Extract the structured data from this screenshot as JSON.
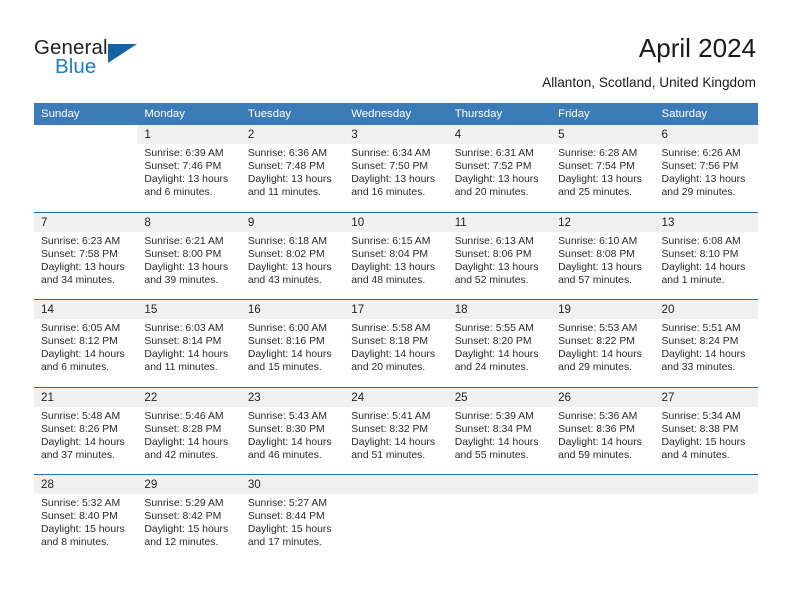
{
  "brand": {
    "word_one": "General",
    "word_two": "Blue",
    "accent_color": "#1b7fc4",
    "triangle_color": "#1464a5",
    "triangle_icon": "triangle-icon"
  },
  "header": {
    "title": "April 2024",
    "location": "Allanton, Scotland, United Kingdom",
    "header_bg_color": "#3b7cb8",
    "band_bg_color": "#f0f0f0",
    "separator_color": "#2e6da4"
  },
  "labels": {
    "sunrise_prefix": "Sunrise:",
    "sunset_prefix": "Sunset:",
    "daylight_prefix": "Daylight:"
  },
  "weekday_headers": [
    "Sunday",
    "Monday",
    "Tuesday",
    "Wednesday",
    "Thursday",
    "Friday",
    "Saturday"
  ],
  "weeks": [
    {
      "days": [
        {
          "num": "",
          "sunrise": "",
          "sunset": "",
          "daylight_1": "",
          "daylight_2": "",
          "empty": true
        },
        {
          "num": "1",
          "sunrise": "Sunrise: 6:39 AM",
          "sunset": "Sunset: 7:46 PM",
          "daylight_1": "Daylight: 13 hours",
          "daylight_2": "and 6 minutes.",
          "empty": false
        },
        {
          "num": "2",
          "sunrise": "Sunrise: 6:36 AM",
          "sunset": "Sunset: 7:48 PM",
          "daylight_1": "Daylight: 13 hours",
          "daylight_2": "and 11 minutes.",
          "empty": false
        },
        {
          "num": "3",
          "sunrise": "Sunrise: 6:34 AM",
          "sunset": "Sunset: 7:50 PM",
          "daylight_1": "Daylight: 13 hours",
          "daylight_2": "and 16 minutes.",
          "empty": false
        },
        {
          "num": "4",
          "sunrise": "Sunrise: 6:31 AM",
          "sunset": "Sunset: 7:52 PM",
          "daylight_1": "Daylight: 13 hours",
          "daylight_2": "and 20 minutes.",
          "empty": false
        },
        {
          "num": "5",
          "sunrise": "Sunrise: 6:28 AM",
          "sunset": "Sunset: 7:54 PM",
          "daylight_1": "Daylight: 13 hours",
          "daylight_2": "and 25 minutes.",
          "empty": false
        },
        {
          "num": "6",
          "sunrise": "Sunrise: 6:26 AM",
          "sunset": "Sunset: 7:56 PM",
          "daylight_1": "Daylight: 13 hours",
          "daylight_2": "and 29 minutes.",
          "empty": false
        }
      ]
    },
    {
      "days": [
        {
          "num": "7",
          "sunrise": "Sunrise: 6:23 AM",
          "sunset": "Sunset: 7:58 PM",
          "daylight_1": "Daylight: 13 hours",
          "daylight_2": "and 34 minutes.",
          "empty": false
        },
        {
          "num": "8",
          "sunrise": "Sunrise: 6:21 AM",
          "sunset": "Sunset: 8:00 PM",
          "daylight_1": "Daylight: 13 hours",
          "daylight_2": "and 39 minutes.",
          "empty": false
        },
        {
          "num": "9",
          "sunrise": "Sunrise: 6:18 AM",
          "sunset": "Sunset: 8:02 PM",
          "daylight_1": "Daylight: 13 hours",
          "daylight_2": "and 43 minutes.",
          "empty": false
        },
        {
          "num": "10",
          "sunrise": "Sunrise: 6:15 AM",
          "sunset": "Sunset: 8:04 PM",
          "daylight_1": "Daylight: 13 hours",
          "daylight_2": "and 48 minutes.",
          "empty": false
        },
        {
          "num": "11",
          "sunrise": "Sunrise: 6:13 AM",
          "sunset": "Sunset: 8:06 PM",
          "daylight_1": "Daylight: 13 hours",
          "daylight_2": "and 52 minutes.",
          "empty": false
        },
        {
          "num": "12",
          "sunrise": "Sunrise: 6:10 AM",
          "sunset": "Sunset: 8:08 PM",
          "daylight_1": "Daylight: 13 hours",
          "daylight_2": "and 57 minutes.",
          "empty": false
        },
        {
          "num": "13",
          "sunrise": "Sunrise: 6:08 AM",
          "sunset": "Sunset: 8:10 PM",
          "daylight_1": "Daylight: 14 hours",
          "daylight_2": "and 1 minute.",
          "empty": false
        }
      ]
    },
    {
      "days": [
        {
          "num": "14",
          "sunrise": "Sunrise: 6:05 AM",
          "sunset": "Sunset: 8:12 PM",
          "daylight_1": "Daylight: 14 hours",
          "daylight_2": "and 6 minutes.",
          "empty": false
        },
        {
          "num": "15",
          "sunrise": "Sunrise: 6:03 AM",
          "sunset": "Sunset: 8:14 PM",
          "daylight_1": "Daylight: 14 hours",
          "daylight_2": "and 11 minutes.",
          "empty": false
        },
        {
          "num": "16",
          "sunrise": "Sunrise: 6:00 AM",
          "sunset": "Sunset: 8:16 PM",
          "daylight_1": "Daylight: 14 hours",
          "daylight_2": "and 15 minutes.",
          "empty": false
        },
        {
          "num": "17",
          "sunrise": "Sunrise: 5:58 AM",
          "sunset": "Sunset: 8:18 PM",
          "daylight_1": "Daylight: 14 hours",
          "daylight_2": "and 20 minutes.",
          "empty": false
        },
        {
          "num": "18",
          "sunrise": "Sunrise: 5:55 AM",
          "sunset": "Sunset: 8:20 PM",
          "daylight_1": "Daylight: 14 hours",
          "daylight_2": "and 24 minutes.",
          "empty": false
        },
        {
          "num": "19",
          "sunrise": "Sunrise: 5:53 AM",
          "sunset": "Sunset: 8:22 PM",
          "daylight_1": "Daylight: 14 hours",
          "daylight_2": "and 29 minutes.",
          "empty": false
        },
        {
          "num": "20",
          "sunrise": "Sunrise: 5:51 AM",
          "sunset": "Sunset: 8:24 PM",
          "daylight_1": "Daylight: 14 hours",
          "daylight_2": "and 33 minutes.",
          "empty": false
        }
      ]
    },
    {
      "days": [
        {
          "num": "21",
          "sunrise": "Sunrise: 5:48 AM",
          "sunset": "Sunset: 8:26 PM",
          "daylight_1": "Daylight: 14 hours",
          "daylight_2": "and 37 minutes.",
          "empty": false
        },
        {
          "num": "22",
          "sunrise": "Sunrise: 5:46 AM",
          "sunset": "Sunset: 8:28 PM",
          "daylight_1": "Daylight: 14 hours",
          "daylight_2": "and 42 minutes.",
          "empty": false
        },
        {
          "num": "23",
          "sunrise": "Sunrise: 5:43 AM",
          "sunset": "Sunset: 8:30 PM",
          "daylight_1": "Daylight: 14 hours",
          "daylight_2": "and 46 minutes.",
          "empty": false
        },
        {
          "num": "24",
          "sunrise": "Sunrise: 5:41 AM",
          "sunset": "Sunset: 8:32 PM",
          "daylight_1": "Daylight: 14 hours",
          "daylight_2": "and 51 minutes.",
          "empty": false
        },
        {
          "num": "25",
          "sunrise": "Sunrise: 5:39 AM",
          "sunset": "Sunset: 8:34 PM",
          "daylight_1": "Daylight: 14 hours",
          "daylight_2": "and 55 minutes.",
          "empty": false
        },
        {
          "num": "26",
          "sunrise": "Sunrise: 5:36 AM",
          "sunset": "Sunset: 8:36 PM",
          "daylight_1": "Daylight: 14 hours",
          "daylight_2": "and 59 minutes.",
          "empty": false
        },
        {
          "num": "27",
          "sunrise": "Sunrise: 5:34 AM",
          "sunset": "Sunset: 8:38 PM",
          "daylight_1": "Daylight: 15 hours",
          "daylight_2": "and 4 minutes.",
          "empty": false
        }
      ]
    },
    {
      "days": [
        {
          "num": "28",
          "sunrise": "Sunrise: 5:32 AM",
          "sunset": "Sunset: 8:40 PM",
          "daylight_1": "Daylight: 15 hours",
          "daylight_2": "and 8 minutes.",
          "empty": false
        },
        {
          "num": "29",
          "sunrise": "Sunrise: 5:29 AM",
          "sunset": "Sunset: 8:42 PM",
          "daylight_1": "Daylight: 15 hours",
          "daylight_2": "and 12 minutes.",
          "empty": false
        },
        {
          "num": "30",
          "sunrise": "Sunrise: 5:27 AM",
          "sunset": "Sunset: 8:44 PM",
          "daylight_1": "Daylight: 15 hours",
          "daylight_2": "and 17 minutes.",
          "empty": false
        },
        {
          "num": "",
          "sunrise": "",
          "sunset": "",
          "daylight_1": "",
          "daylight_2": "",
          "empty": false
        },
        {
          "num": "",
          "sunrise": "",
          "sunset": "",
          "daylight_1": "",
          "daylight_2": "",
          "empty": false
        },
        {
          "num": "",
          "sunrise": "",
          "sunset": "",
          "daylight_1": "",
          "daylight_2": "",
          "empty": false
        },
        {
          "num": "",
          "sunrise": "",
          "sunset": "",
          "daylight_1": "",
          "daylight_2": "",
          "empty": false
        }
      ]
    }
  ]
}
